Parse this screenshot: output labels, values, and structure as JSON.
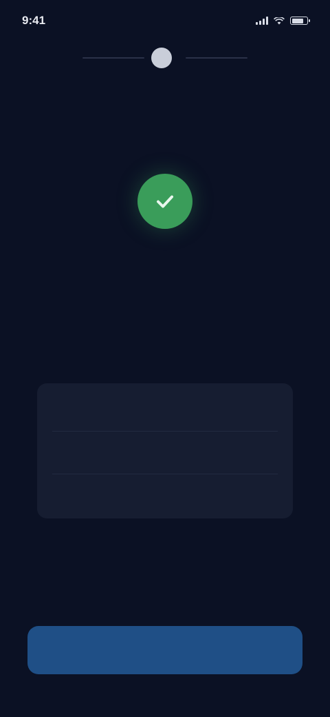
{
  "status_bar": {
    "time": "9:41",
    "signal_icon": "signal-icon",
    "wifi_icon": "wifi-icon",
    "battery_icon": "battery-icon",
    "battery_level": 0.8
  },
  "header": {
    "logo_icon": "app-logo-icon",
    "logo_letter": "",
    "title": ""
  },
  "success": {
    "icon": "check-icon",
    "color": "#3a9d5a"
  },
  "title": "",
  "subtitle": "",
  "details": {
    "rows": [
      {
        "label": "",
        "value": ""
      },
      {
        "label": "",
        "value": ""
      }
    ],
    "total": {
      "label": "",
      "value": "",
      "value_color": "#4cae6c"
    }
  },
  "primary_button": {
    "label": ""
  },
  "colors": {
    "background": "#0b1124",
    "card": "#161d31",
    "accent_button": "#1f4f86",
    "success": "#3a9d5a"
  }
}
